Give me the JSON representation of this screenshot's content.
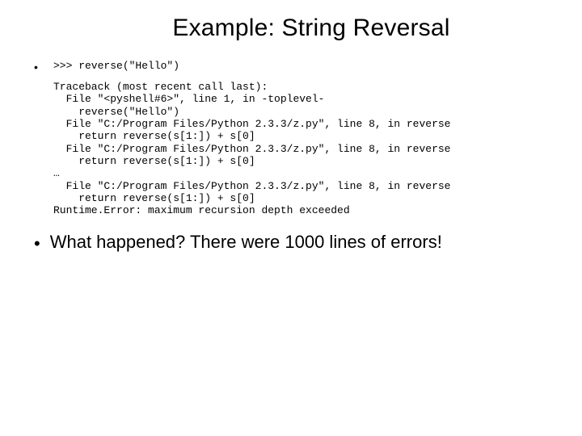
{
  "title": "Example: String Reversal",
  "code_line": ">>> reverse(\"Hello\")",
  "traceback": {
    "header": "Traceback (most recent call last):",
    "l1": "  File \"<pyshell#6>\", line 1, in -toplevel-",
    "l2": "    reverse(\"Hello\")",
    "l3": "  File \"C:/Program Files/Python 2.3.3/z.py\", line 8, in reverse",
    "l4": "    return reverse(s[1:]) + s[0]",
    "l5": "  File \"C:/Program Files/Python 2.3.3/z.py\", line 8, in reverse",
    "l6": "    return reverse(s[1:]) + s[0]",
    "ellipsis": "…",
    "l7": "  File \"C:/Program Files/Python 2.3.3/z.py\", line 8, in reverse",
    "l8": "    return reverse(s[1:]) + s[0]",
    "err": "Runtime.Error: maximum recursion depth exceeded"
  },
  "summary": "What happened? There were 1000 lines of errors!"
}
